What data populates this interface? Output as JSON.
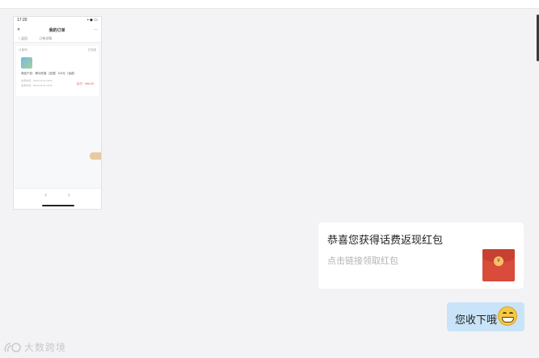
{
  "phone_preview": {
    "status_time": "17:20",
    "status_right": "▪ ◆ ▭",
    "nav_back": "✕",
    "nav_title": "我的订单",
    "nav_more": "···",
    "sub_back": "〈 返回",
    "sub_title": "订单详情",
    "order_label": "订单号：",
    "order_state": "已完成",
    "product_line": "商品产品：移动充值（全国）100元（话费）",
    "meta_line_1": "充值时间：2020-03-19 18:32",
    "meta_line_2": "完成时间：2020-03-19 18:33",
    "price": "实付：¥96.00",
    "nav_prev": "‹",
    "nav_next": "›"
  },
  "red_packet": {
    "title": "恭喜您获得话费返现红包",
    "subtitle": "点击链接领取红包",
    "seal_glyph": "¥"
  },
  "message": {
    "text": "您收下哦"
  },
  "watermark": {
    "text": "大数跨境"
  },
  "colors": {
    "background": "#f3f3f5",
    "bubble": "#c9e4f8",
    "red_packet": "#d94b3a"
  }
}
